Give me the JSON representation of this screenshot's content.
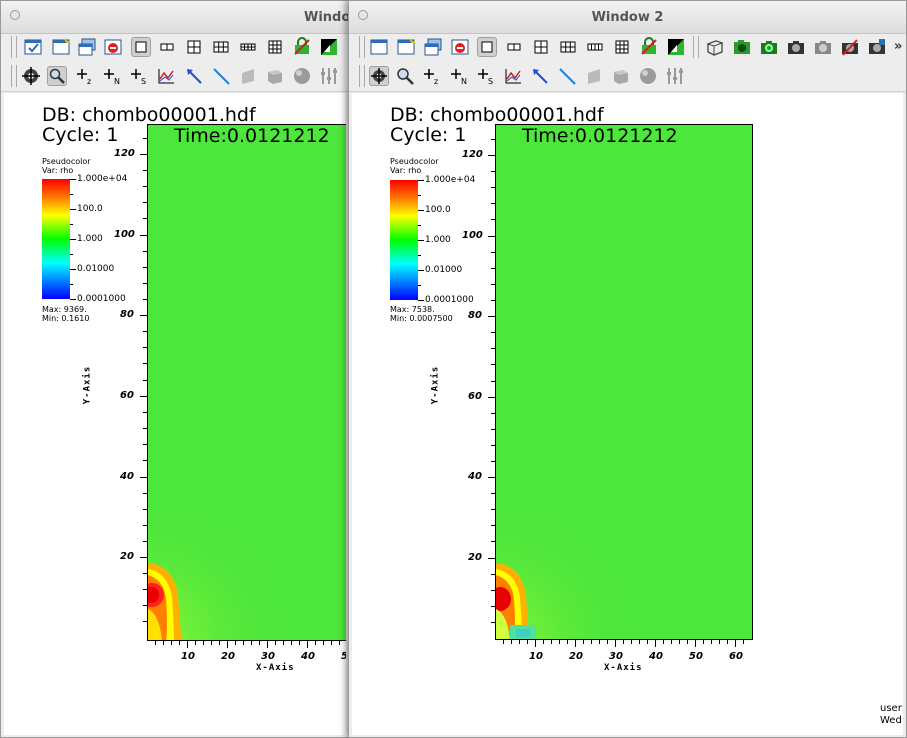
{
  "windows": [
    {
      "title": "Window",
      "db_label": "DB: chombo00001.hdf",
      "cycle_label": "Cycle: 1",
      "time_label": "Time:0.0121212",
      "legend": {
        "plot_type": "Pseudocolor",
        "variable": "Var: rho",
        "ticks": [
          "1.000e+04",
          "100.0",
          "1.000",
          "0.01000",
          "0.0001000"
        ],
        "max_label": "Max:  9369.",
        "min_label": "Min:  0.1610"
      },
      "axes": {
        "xlabel": "X-Axis",
        "ylabel": "Y-Axis",
        "xticks": [
          "10",
          "20",
          "30",
          "40",
          "5"
        ],
        "yticks": [
          "120",
          "100",
          "80",
          "60",
          "40",
          "20"
        ]
      }
    },
    {
      "title": "Window 2",
      "db_label": "DB: chombo00001.hdf",
      "cycle_label": "Cycle: 1",
      "time_label": "Time:0.0121212",
      "legend": {
        "plot_type": "Pseudocolor",
        "variable": "Var: rho",
        "ticks": [
          "1.000e+04",
          "100.0",
          "1.000",
          "0.01000",
          "0.0001000"
        ],
        "max_label": "Max:  7538.",
        "min_label": "Min:  0.0007500"
      },
      "axes": {
        "xlabel": "X-Axis",
        "ylabel": "Y-Axis",
        "xticks": [
          "10",
          "20",
          "30",
          "40",
          "50",
          "60"
        ],
        "yticks": [
          "120",
          "100",
          "80",
          "60",
          "40",
          "20"
        ]
      },
      "user_label": "user:",
      "date_label": "Wed"
    }
  ],
  "toolbar_row1_icons": [
    "new-window-icon",
    "clear-window-icon",
    "copy-window-icon",
    "delete-window-icon",
    "layout-1x1-icon",
    "layout-1x2-icon",
    "layout-2x2-icon",
    "layout-2x3-icon",
    "layout-2x4-icon",
    "layout-3x3-icon",
    "lock-view-icon",
    "invert-background-icon"
  ],
  "toolbar_row1_extra_icons": [
    "spin-mode-icon",
    "save-image-icon",
    "camera-icon",
    "camera-alt-icon",
    "camera-disabled-icon",
    "camera-off-icon",
    "camera-lock-icon"
  ],
  "toolbar_row2_icons": [
    "navigate-icon",
    "zoom-icon",
    "add-zone-pick-icon",
    "add-node-pick-icon",
    "add-spreadsheet-pick-icon",
    "curve-lineout-icon",
    "pick-icon",
    "lineout-icon",
    "box-tool-icon",
    "plane-tool-icon",
    "sphere-tool-icon",
    "slider-tool-icon"
  ],
  "more_label": "»",
  "colors": {
    "field": "#4de63c",
    "legend_gradient": [
      "#ff0000",
      "#ff8000",
      "#ffff00",
      "#00ff00",
      "#00ffff",
      "#0000ff"
    ],
    "window_bg": "#ededed"
  }
}
